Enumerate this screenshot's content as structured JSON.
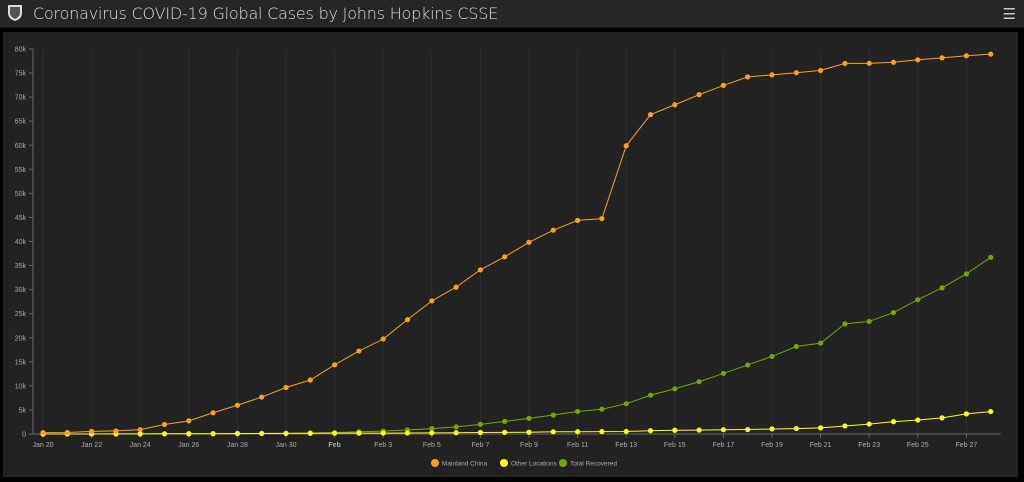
{
  "header": {
    "title": "Coronavirus COVID-19 Global Cases by Johns Hopkins CSSE",
    "menu_icon": "hamburger-icon",
    "logo_icon": "jhu-shield-icon"
  },
  "chart_data": {
    "type": "line",
    "title": "",
    "xlabel": "",
    "ylabel": "",
    "ylim": [
      0,
      80000
    ],
    "y_ticks": [
      "0",
      "5k",
      "10k",
      "15k",
      "20k",
      "25k",
      "30k",
      "35k",
      "40k",
      "45k",
      "50k",
      "55k",
      "60k",
      "65k",
      "70k",
      "75k",
      "80k"
    ],
    "x_ticks": [
      "Jan 20",
      "Jan 22",
      "Jan 24",
      "Jan 26",
      "Jan 28",
      "Jan 30",
      "Feb",
      "Feb 3",
      "Feb 5",
      "Feb 7",
      "Feb 9",
      "Feb 11",
      "Feb 13",
      "Feb 15",
      "Feb 17",
      "Feb 19",
      "Feb 21",
      "Feb 23",
      "Feb 25",
      "Feb 27"
    ],
    "x_start": "Jan 20",
    "x_days": 40,
    "legend_position": "bottom",
    "series": [
      {
        "name": "Mainland China",
        "color": "#f7a21b",
        "values": [
          278,
          310,
          547,
          639,
          916,
          1979,
          2737,
          4409,
          5970,
          7678,
          9658,
          11221,
          14375,
          17238,
          19733,
          23760,
          27657,
          30523,
          34110,
          36814,
          39829,
          42354,
          44386,
          44759,
          59895,
          66358,
          68413,
          70513,
          72434,
          74211,
          74619,
          75077,
          75550,
          77001,
          77022,
          77241,
          77754,
          78166,
          78600,
          78928
        ]
      },
      {
        "name": "Other Locations",
        "color": "#ffff00",
        "values": [
          4,
          6,
          8,
          14,
          25,
          40,
          57,
          64,
          87,
          105,
          118,
          153,
          173,
          183,
          188,
          212,
          227,
          265,
          317,
          343,
          361,
          457,
          476,
          503,
          526,
          683,
          780,
          812,
          896,
          924,
          1051,
          1128,
          1277,
          1670,
          2061,
          2552,
          2902,
          3356,
          4187,
          4660
        ]
      },
      {
        "name": "Total Recovered",
        "color": "#70a800",
        "values": [
          0,
          0,
          28,
          30,
          36,
          39,
          49,
          58,
          101,
          120,
          135,
          214,
          275,
          463,
          614,
          843,
          1115,
          1476,
          2011,
          2616,
          3244,
          3946,
          4683,
          5150,
          6295,
          8058,
          9395,
          10865,
          12583,
          14352,
          16121,
          18177,
          18890,
          22886,
          23394,
          25227,
          27905,
          30384,
          33277,
          36711
        ]
      }
    ]
  }
}
